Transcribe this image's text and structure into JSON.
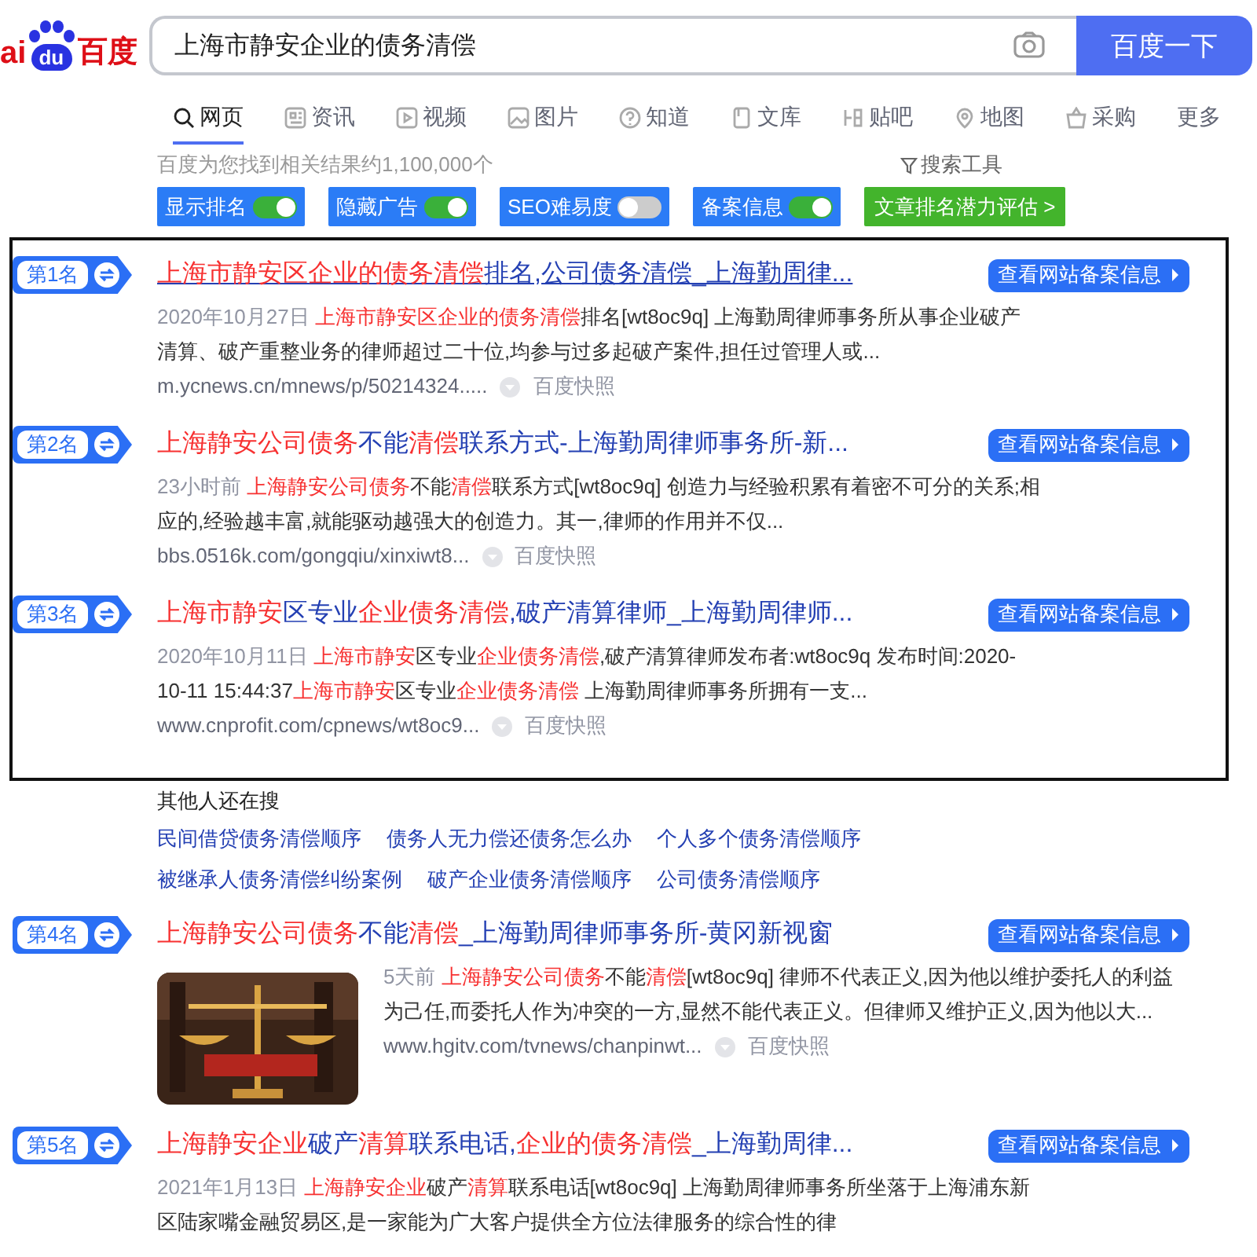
{
  "logo": {
    "left": "ai",
    "paw": "du",
    "name": "百度"
  },
  "search": {
    "value": "上海市静安企业的债务清偿",
    "button": "百度一下"
  },
  "tabs": [
    {
      "label": "网页",
      "selected": true
    },
    {
      "label": "资讯",
      "selected": false
    },
    {
      "label": "视频",
      "selected": false
    },
    {
      "label": "图片",
      "selected": false
    },
    {
      "label": "知道",
      "selected": false
    },
    {
      "label": "文库",
      "selected": false
    },
    {
      "label": "贴吧",
      "selected": false
    },
    {
      "label": "地图",
      "selected": false
    },
    {
      "label": "采购",
      "selected": false
    },
    {
      "label": "更多",
      "selected": false
    }
  ],
  "result_count": "百度为您找到相关结果约1,100,000个",
  "search_tools": "搜索工具",
  "toggles": [
    {
      "label": "显示排名",
      "on": true
    },
    {
      "label": "隐藏广告",
      "on": true
    },
    {
      "label": "SEO难易度",
      "on": false
    },
    {
      "label": "备案信息",
      "on": true
    }
  ],
  "evaluate_button": "文章排名潜力评估 >",
  "boxed_results": [
    {
      "rank": "第1名",
      "underlined": true,
      "title": [
        {
          "text": "上海市静安区企业的债务清偿",
          "highlight": true
        },
        {
          "text": "排名,公司债务清偿_上海勤周律...",
          "highlight": false
        }
      ],
      "record_button": "查看网站备案信息",
      "date": "2020年10月27日",
      "snippet": [
        {
          "text": "上海市静安区企业的债务清偿",
          "highlight": true
        },
        {
          "text": "排名[wt8oc9q] 上海勤周律师事务所从事企业破产清算、破产重整业务的律师超过二十位,均参与过多起破产案件,担任过管理人或...",
          "highlight": false
        }
      ],
      "url": "m.ycnews.cn/mnews/p/50214324.....",
      "snapshot": "百度快照"
    },
    {
      "rank": "第2名",
      "underlined": false,
      "title": [
        {
          "text": "上海静安公司债务",
          "highlight": true
        },
        {
          "text": "不能",
          "highlight": false
        },
        {
          "text": "清偿",
          "highlight": true
        },
        {
          "text": "联系方式-上海勤周律师事务所-新...",
          "highlight": false
        }
      ],
      "record_button": "查看网站备案信息",
      "date": "23小时前",
      "snippet": [
        {
          "text": "上海静安公司债务",
          "highlight": true
        },
        {
          "text": "不能",
          "highlight": false
        },
        {
          "text": "清偿",
          "highlight": true
        },
        {
          "text": "联系方式[wt8oc9q] 创造力与经验积累有着密不可分的关系;相应的,经验越丰富,就能驱动越强大的创造力。其一,律师的作用并不仅...",
          "highlight": false
        }
      ],
      "url": "bbs.0516k.com/gongqiu/xinxiwt8...",
      "snapshot": "百度快照"
    },
    {
      "rank": "第3名",
      "underlined": false,
      "title": [
        {
          "text": "上海市静安",
          "highlight": true
        },
        {
          "text": "区专业",
          "highlight": false
        },
        {
          "text": "企业债务清偿",
          "highlight": true
        },
        {
          "text": ",破产清算律师_上海勤周律师...",
          "highlight": false
        }
      ],
      "record_button": "查看网站备案信息",
      "date": "2020年10月11日",
      "snippet": [
        {
          "text": "上海市静安",
          "highlight": true
        },
        {
          "text": "区专业",
          "highlight": false
        },
        {
          "text": "企业债务清偿",
          "highlight": true
        },
        {
          "text": ",破产清算律师发布者:wt8oc9q 发布时间:2020-10-11 15:44:37",
          "highlight": false
        },
        {
          "text": "上海市静安",
          "highlight": true
        },
        {
          "text": "区专业",
          "highlight": false
        },
        {
          "text": "企业债务清偿",
          "highlight": true
        },
        {
          "text": " 上海勤周律师事务所拥有一支...",
          "highlight": false
        }
      ],
      "url": "www.cnprofit.com/cpnews/wt8oc9...",
      "snapshot": "百度快照"
    }
  ],
  "related": {
    "title": "其他人还在搜",
    "rows": [
      [
        "民间借贷债务清偿顺序",
        "债务人无力偿还债务怎么办",
        "个人多个债务清偿顺序"
      ],
      [
        "被继承人债务清偿纠纷案例",
        "破产企业债务清偿顺序",
        "公司债务清偿顺序"
      ]
    ]
  },
  "results": [
    {
      "rank": "第4名",
      "underlined": false,
      "title": [
        {
          "text": "上海静安公司债务",
          "highlight": true
        },
        {
          "text": "不能",
          "highlight": false
        },
        {
          "text": "清偿",
          "highlight": true
        },
        {
          "text": "_上海勤周律师事务所-黄冈新视窗",
          "highlight": false
        }
      ],
      "record_button": "查看网站备案信息",
      "date": "5天前",
      "snippet": [
        {
          "text": "上海静安公司债务",
          "highlight": true
        },
        {
          "text": "不能",
          "highlight": false
        },
        {
          "text": "清偿",
          "highlight": true
        },
        {
          "text": "[wt8oc9q] 律师不代表正义,因为他以维护委托人的利益为己任,而委托人作为冲突的一方,显然不能代表正义。但律师又维护正义,因为他以大...",
          "highlight": false
        }
      ],
      "url": "www.hgitv.com/tvnews/chanpinwt...",
      "snapshot": "百度快照"
    },
    {
      "rank": "第5名",
      "underlined": false,
      "title": [
        {
          "text": "上海静安企业",
          "highlight": true
        },
        {
          "text": "破产",
          "highlight": false
        },
        {
          "text": "清算",
          "highlight": true
        },
        {
          "text": "联系电话,",
          "highlight": false
        },
        {
          "text": "企业的债务清偿",
          "highlight": true
        },
        {
          "text": "_上海勤周律...",
          "highlight": false
        }
      ],
      "record_button": "查看网站备案信息",
      "date": "2021年1月13日",
      "snippet": [
        {
          "text": "上海静安企业",
          "highlight": true
        },
        {
          "text": "破产",
          "highlight": false
        },
        {
          "text": "清算",
          "highlight": true
        },
        {
          "text": "联系电话[wt8oc9q] 上海勤周律师事务所坐落于上海浦东新区陆家嘴金融贸易区,是一家能为广大客户提供全方位法律服务的综合性的律",
          "highlight": false
        }
      ]
    }
  ]
}
